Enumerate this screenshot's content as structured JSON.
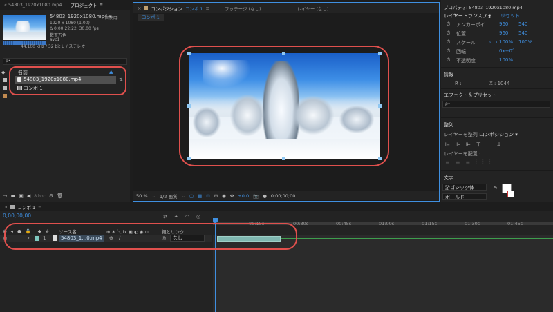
{
  "project_panel": {
    "tab_prev": "« 54803_1920x1080.mp4",
    "tab_active": "プロジェクト",
    "file_name": "54803_1920x1080.mp4 ▾",
    "use_count": "1 回使用",
    "resolution": "1920 x 1080 (1.00)",
    "duration": "Δ 0;00;22;22, 30.00 fps",
    "colors": "数百万色",
    "codec": "avc1",
    "audio": "44.100 kHz / 32 bit U / ステレオ",
    "search_placeholder": "",
    "col_name": "名前",
    "items": [
      {
        "label": "54803_1920x1080.mp4",
        "selected": true
      },
      {
        "label": "コンポ 1",
        "selected": false
      }
    ],
    "bpc": "8 bpc"
  },
  "comp_panel": {
    "tab_label": "コンポジション",
    "tab_comp": "コンポ 1",
    "tab_footage": "フッテージ (なし)",
    "tab_layer": "レイヤー (なし)",
    "sub_tab": "コンポ 1",
    "zoom": "50 %",
    "quality": "1/2 画質",
    "exposure": "+0.0",
    "timecode": "0;00;00;00"
  },
  "properties": {
    "title": "プロパティ: 54803_1920x1080.mp4",
    "section": "レイヤートランスフォ…",
    "reset": "リセット",
    "rows": [
      {
        "label": "アンカーポイ…",
        "v1": "960",
        "v2": "540"
      },
      {
        "label": "位置",
        "v1": "960",
        "v2": "540"
      },
      {
        "label": "スケール",
        "v1": "100%",
        "v2": "100%"
      },
      {
        "label": "回転",
        "v1": "0x+0°",
        "v2": ""
      },
      {
        "label": "不透明度",
        "v1": "100%",
        "v2": ""
      }
    ]
  },
  "info": {
    "title": "情報",
    "r": "R :",
    "x": "X : 1044"
  },
  "effects": {
    "title": "エフェクト＆プリセット",
    "search_placeholder": "ρ•"
  },
  "align": {
    "title": "整列",
    "align_to_label": "レイヤーを整列 :",
    "align_to_value": "コンポジション ▾",
    "distribute_label": "レイヤーを配置 :"
  },
  "text_panel": {
    "title": "文字",
    "font": "游ゴシック体",
    "style": "ボールド"
  },
  "timeline": {
    "tab": "コンポ 1",
    "timecode": "0;00;00;00",
    "col_num": "#",
    "col_source": "ソース名",
    "col_switches": "⊕ ✶ ＼ fx ▣ ◐ ◉ ⊙",
    "col_parent": "親とリンク",
    "layer_num": "1",
    "layer_name": "54803_1…0.mp4",
    "parent_value": "なし",
    "ruler": [
      "00:15s",
      "00:30s",
      "00:45s",
      "01:00s",
      "01:15s",
      "01:30s",
      "01:45s"
    ]
  },
  "colors": {
    "accent": "#3f8fe0",
    "highlight_ring": "#e0504d",
    "clip_bar": "#7fb7b0"
  }
}
